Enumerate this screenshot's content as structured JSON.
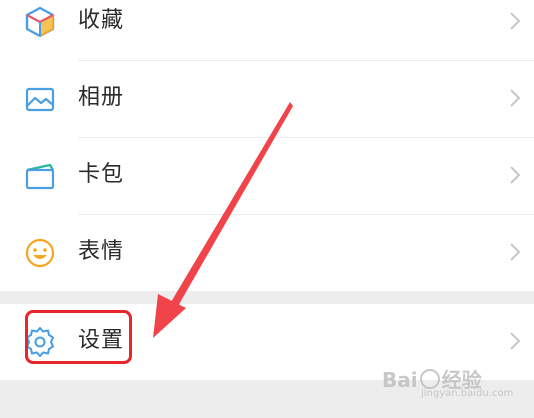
{
  "menu": {
    "items": [
      {
        "label": "收藏",
        "icon": "favorites-cube-icon"
      },
      {
        "label": "相册",
        "icon": "album-image-icon"
      },
      {
        "label": "卡包",
        "icon": "card-wallet-icon"
      },
      {
        "label": "表情",
        "icon": "emoji-smile-icon"
      },
      {
        "label": "设置",
        "icon": "settings-gear-icon"
      }
    ]
  },
  "annotation": {
    "highlight_color": "#e8252a",
    "arrow_color": "#f0444a"
  },
  "watermark": {
    "brand": "Bai",
    "brand_suffix": "经验",
    "sub": "jingyan.baidu.com"
  },
  "colors": {
    "text": "#2b2b2b",
    "chevron": "#c7c7c7",
    "gap": "#ededed",
    "icon_blue": "#4a9fe3",
    "icon_orange": "#f5a623"
  }
}
